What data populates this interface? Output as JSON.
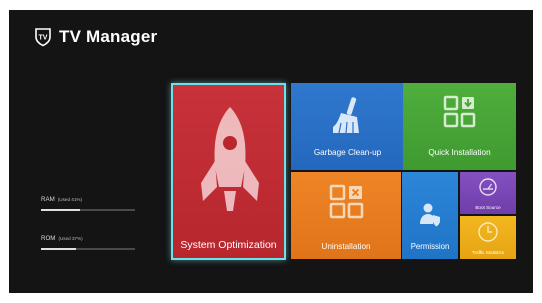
{
  "app": {
    "title": "TV Manager",
    "logo_icon": "tv-shield-logo-icon"
  },
  "stats": [
    {
      "name": "RAM",
      "detail": "(Used 41%)",
      "used_fraction": 0.41
    },
    {
      "name": "ROM",
      "detail": "(Used 37%)",
      "used_fraction": 0.37
    }
  ],
  "tiles": {
    "system_optimization": {
      "label": "System Optimization",
      "icon": "rocket-icon",
      "color": "#c0272f",
      "selected": true
    },
    "garbage_cleanup": {
      "label": "Garbage Clean-up",
      "icon": "broom-icon",
      "color": "#2a70c8"
    },
    "quick_installation": {
      "label": "Quick Installation",
      "icon": "app-grid-download-icon",
      "color": "#47a436"
    },
    "uninstallation": {
      "label": "Uninstallation",
      "icon": "app-grid-remove-icon",
      "color": "#e97c20"
    },
    "permission": {
      "label": "Permission",
      "icon": "user-shield-icon",
      "color": "#257dd0"
    },
    "boot_source": {
      "label": "Boot Source",
      "icon": "gauge-icon",
      "color": "#7a46b5"
    },
    "traffic_statistics": {
      "label": "Traffic Statistics",
      "icon": "clock-icon",
      "color": "#efae1a"
    }
  },
  "colors": {
    "background": "#141414",
    "focus_border": "#6ee0ea"
  }
}
